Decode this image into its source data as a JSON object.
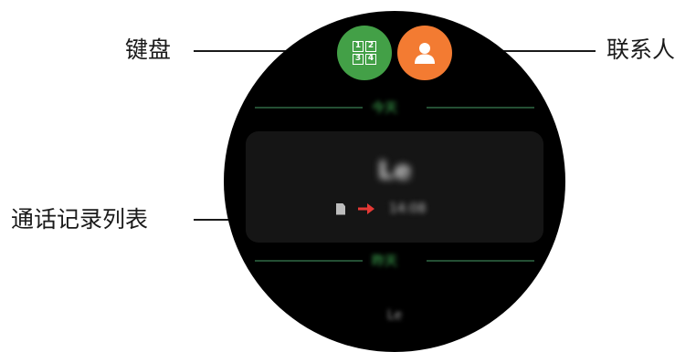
{
  "callouts": {
    "keypad": "键盘",
    "contacts": "联系人",
    "call_log_list": "通话记录列表"
  },
  "watch": {
    "keypad_button": {
      "keys": [
        "1",
        "2",
        "3",
        "4"
      ],
      "color": "#43a047"
    },
    "contacts_button": {
      "icon": "person-icon",
      "color": "#f37b32"
    },
    "section_today": "今天",
    "section_yesterday": "昨天",
    "entry": {
      "name": "Le",
      "sim_icon": "sim-card-icon",
      "direction_icon": "outgoing-arrow-icon",
      "time": "14:08"
    },
    "next_entry": "Le"
  },
  "colors": {
    "accent_green": "#2e7d3c",
    "outgoing_arrow": "#e53935"
  }
}
